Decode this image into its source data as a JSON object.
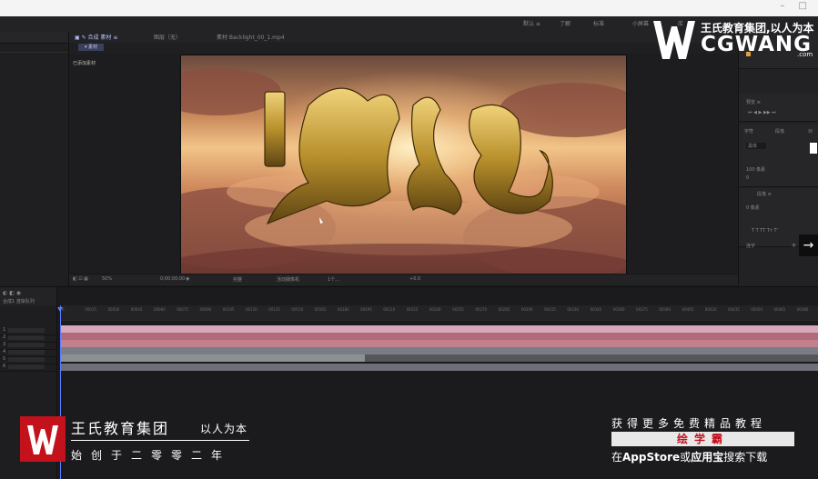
{
  "window": {
    "controls": "– □"
  },
  "menubar": {
    "items": [
      "默认 ≡",
      "了解",
      "标准",
      "小屏幕",
      "库"
    ]
  },
  "comp_tabs": {
    "tab1": "▣ ✎ 合成 素材 ≡",
    "tab2": "图层（无）",
    "tab3": "素材 Backlight_00_1.mp4",
    "chip": "▾ 素材"
  },
  "layer_label": "已添加素材",
  "viewer_bar": {
    "zoom": "50%",
    "timecode": "0;00;00;00",
    "quality": "完整",
    "camera": "活动摄像机",
    "view": "1个...",
    "offset": "+0.0"
  },
  "right_panel": {
    "preview": "预览 ≡",
    "tabs": [
      "字符",
      "段落",
      "对"
    ],
    "font": "黑体",
    "size": "100 像素",
    "leading": "自动",
    "tracking": "0",
    "paragraph_tab": "段落 ≡",
    "align_label": "0 像素",
    "checkbox1": "连字",
    "checkbox2": "平"
  },
  "timeline": {
    "comp_name": "合成1 渲染队列",
    "ruler_ticks": [
      "0",
      "00015",
      "00030",
      "00045",
      "00060",
      "00075",
      "00090",
      "00105",
      "00120",
      "00135",
      "00150",
      "00165",
      "00180",
      "00195",
      "00210",
      "00225",
      "00240",
      "00255",
      "00270",
      "00285",
      "00300",
      "00315",
      "00330",
      "00345",
      "00360",
      "00375",
      "00390",
      "00405",
      "00420",
      "00435",
      "00450",
      "00465",
      "00480"
    ],
    "layers": [
      "1",
      "2",
      "3",
      "4",
      "5",
      "6"
    ]
  },
  "watermark": {
    "cn_line1": "王氏教育集团,以人为本",
    "cn_line2": "CGWANG",
    "com": ".com"
  },
  "branding": {
    "company": "王氏教育集团",
    "motto": "以人为本",
    "since": "始创于二零零二年"
  },
  "promo": {
    "line1": "获得更多免费精品教程",
    "line2": "绘学霸",
    "line3_a": "在",
    "line3_b": "AppStore",
    "line3_c": "或",
    "line3_d": "应用宝",
    "line3_e": "搜索下载"
  },
  "colors": {
    "accent": "#5b7cff",
    "gold": "#b8902c",
    "red": "#c4121c"
  },
  "icons": [
    "minimize-icon",
    "chevron-right-icon",
    "play-icon",
    "camera-icon",
    "lock-icon",
    "eye-icon"
  ]
}
